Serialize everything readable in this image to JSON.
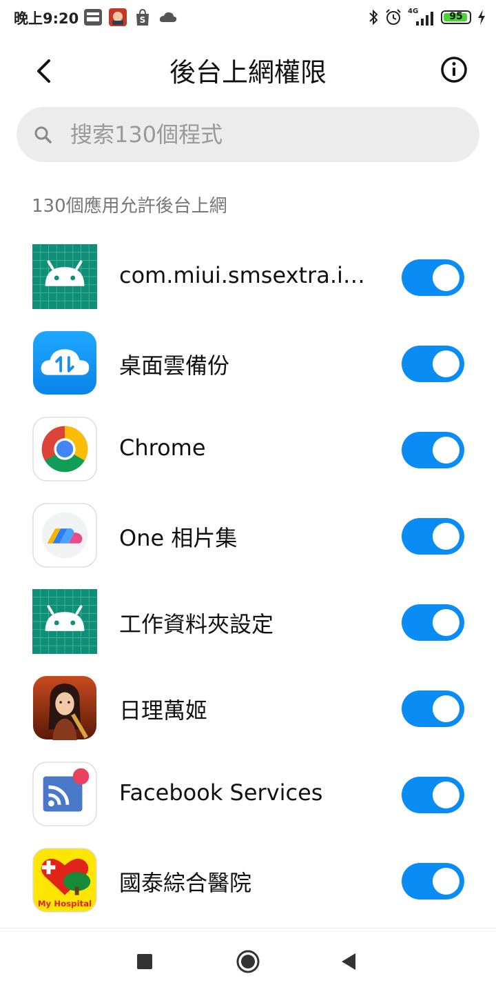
{
  "status_bar": {
    "time": "晚上9:20",
    "network": "4G",
    "battery": "95",
    "battery_level": 0.95,
    "notification_icons": [
      "myvideo-icon",
      "game-avatar-icon",
      "shopee-icon",
      "cloud-icon"
    ],
    "system_icons": [
      "bluetooth-icon",
      "alarm-icon",
      "signal-icon",
      "battery-icon",
      "charging-icon"
    ]
  },
  "header": {
    "title": "後台上網權限",
    "back_icon": "back-arrow-icon",
    "info_icon": "info-icon"
  },
  "search": {
    "placeholder": "搜索130個程式",
    "value": ""
  },
  "summary": "130個應用允許後台上網",
  "apps": [
    {
      "name": "com.miui.smsextra.int…",
      "icon": "android-default-icon",
      "enabled": true
    },
    {
      "name": "桌面雲備份",
      "icon": "cloud-backup-icon",
      "enabled": true
    },
    {
      "name": "Chrome",
      "icon": "chrome-icon",
      "enabled": true
    },
    {
      "name": "One 相片集",
      "icon": "one-gallery-icon",
      "enabled": true
    },
    {
      "name": "工作資料夾設定",
      "icon": "android-default-icon",
      "enabled": true
    },
    {
      "name": "日理萬姬",
      "icon": "game-character-icon",
      "enabled": true
    },
    {
      "name": "Facebook Services",
      "icon": "facebook-services-icon",
      "enabled": true
    },
    {
      "name": "國泰綜合醫院",
      "icon": "my-hospital-icon",
      "my_hospital_label": "My Hospital",
      "enabled": true
    }
  ],
  "nav_bar": {
    "buttons": [
      "recents-icon",
      "home-icon",
      "back-icon"
    ]
  },
  "colors": {
    "accent": "#0a8cf5",
    "search_bg": "#ececec",
    "android_tile": "#0f8e78",
    "battery_green": "#4cd137"
  }
}
